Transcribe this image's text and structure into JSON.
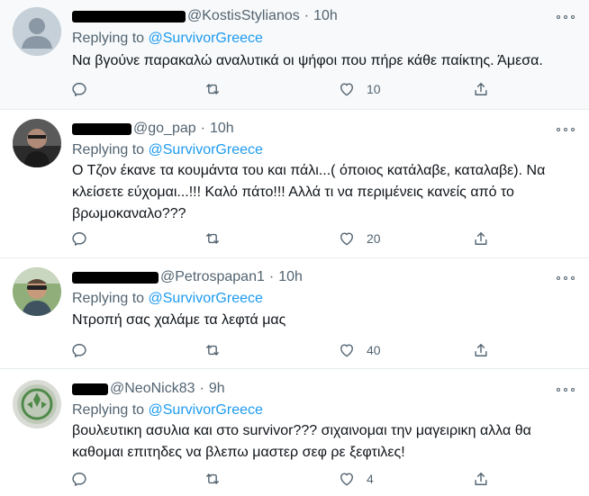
{
  "tweets": [
    {
      "handle": "@KostisStylianos",
      "time": "10h",
      "reply_prefix": "Replying to",
      "reply_user": "@SurvivorGreece",
      "text": "Να βγούνε παρακαλώ  αναλυτικά οι ψήφοι που πήρε κάθε παίκτης. Άμεσα.",
      "likes": "10"
    },
    {
      "handle": "@go_pap",
      "time": "10h",
      "reply_prefix": "Replying to",
      "reply_user": "@SurvivorGreece",
      "text": "Ο Τζον έκανε τα κουμάντα του και πάλι...( όποιος κατάλαβε, καταλαβε). Να κλείσετε εύχομαι...!!! Καλό πάτο!!! Αλλά τι να περιμένεις κανείς από το βρωμοκαναλο???",
      "likes": "20"
    },
    {
      "handle": "@Petrospapan1",
      "time": "10h",
      "reply_prefix": "Replying to",
      "reply_user": "@SurvivorGreece",
      "text": "Ντροπή σας χαλάμε τα λεφτά μας",
      "likes": "40"
    },
    {
      "handle": "@NeoNick83",
      "time": "9h",
      "reply_prefix": "Replying to",
      "reply_user": "@SurvivorGreece",
      "text": "βουλευτικη ασυλια και στο survivor??? σιχαινομαι την μαγειρικη αλλα θα καθομαι επιτηδες να βλεπω μαστερ σεφ ρε ξεφτιλες!",
      "likes": "4"
    }
  ],
  "colors": {
    "link": "#1d9bf0",
    "muted": "#536471",
    "text": "#0f1419",
    "highlight_bg": "#f7f9fa",
    "divider": "#e6ecf0"
  },
  "icons": [
    "more-icon",
    "reply-icon",
    "retweet-icon",
    "like-icon",
    "share-icon"
  ]
}
